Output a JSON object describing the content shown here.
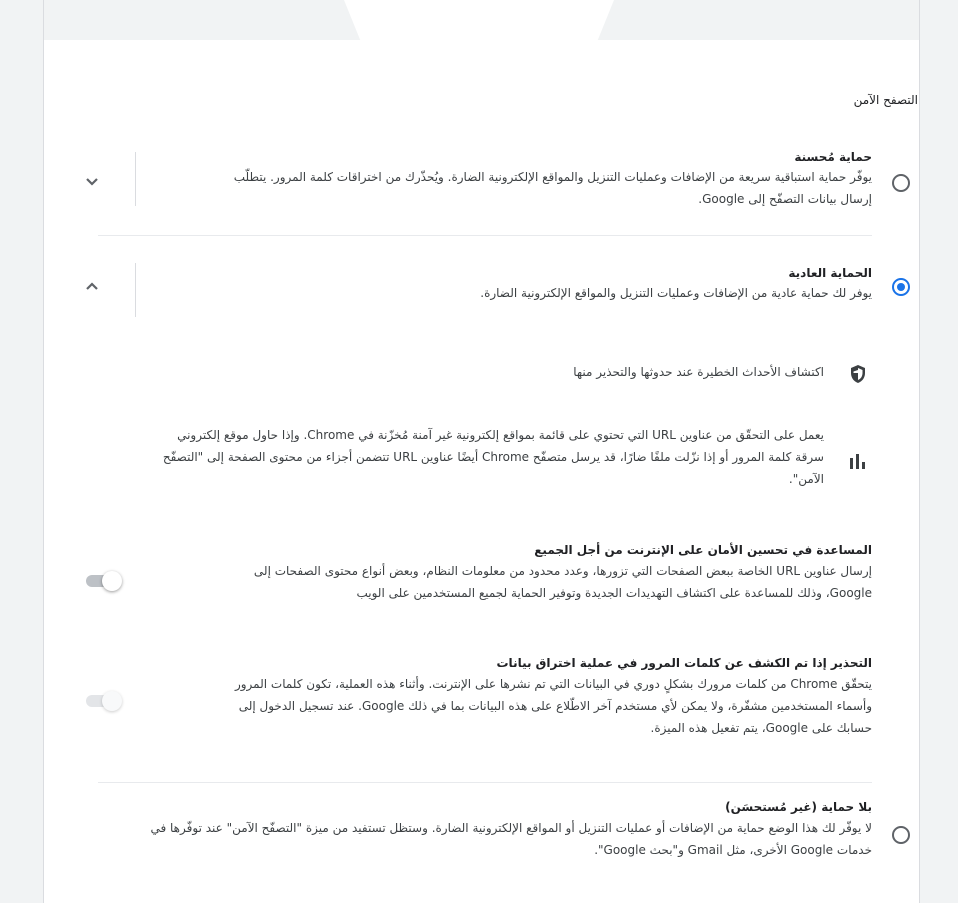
{
  "section_title": "التصفح الآمن",
  "options": {
    "enhanced": {
      "title": "حماية مُحسنة",
      "desc_line1": "يوفّر حماية استباقية سريعة من الإضافات وعمليات التنزيل والمواقع الإلكترونية الضارة. ويُحذّرك من اختراقات كلمة المرور. يتطلّب",
      "desc_line2": "إرسال بيانات التصفّح إلى Google."
    },
    "standard": {
      "title": "الحماية العادية",
      "desc": "يوفر لك حماية عادية من الإضافات وعمليات التنزيل والمواقع الإلكترونية الضارة.",
      "detail1": "اكتشاف الأحداث الخطيرة عند حدوثها والتحذير منها",
      "detail2_line1": "يعمل على التحقّق من عناوين URL التي تحتوي على قائمة بمواقع إلكترونية غير آمنة مُخزّنة في Chrome. وإذا حاول موقع إلكتروني",
      "detail2_line2": "سرقة كلمة المرور أو إذا نزّلت ملفًا ضارًا، قد يرسل متصفّح Chrome أيضًا عناوين URL تتضمن أجزاء من محتوى الصفحة إلى \"التصفّح",
      "detail2_line3": "الآمن\"."
    },
    "none": {
      "title": "بلا حماية (غير مُستحسَن)",
      "desc_line1": "لا يوفّر لك هذا الوضع حماية من الإضافات أو عمليات التنزيل أو المواقع الإلكترونية الضارة. وستظل تستفيد من ميزة \"التصفّح الآمن\" عند توفّرها في",
      "desc_line2": "خدمات Google الأخرى، مثل Gmail و\"بحث Google\"."
    }
  },
  "toggles": {
    "improve": {
      "title": "المساعدة في تحسين الأمان على الإنترنت من أجل الجميع",
      "line1": "إرسال عناوين URL الخاصة ببعض الصفحات التي تزورها، وعدد محدود من معلومات النظام، وبعض أنواع محتوى الصفحات إلى",
      "line2": "Google، وذلك للمساعدة على اكتشاف التهديدات الجديدة وتوفير الحماية لجميع المستخدمين على الويب",
      "state": "off"
    },
    "breach": {
      "title": "التحذير إذا تم الكشف عن كلمات المرور في عملية اختراق بيانات",
      "line1": "يتحقّق Chrome من كلمات مرورك بشكلٍ دوري في البيانات التي تم نشرها على الإنترنت. وأثناء هذه العملية، تكون كلمات المرور",
      "line2": "وأسماء المستخدمين مشفّرة، ولا يمكن لأي مستخدم آخر الاطّلاع على هذه البيانات بما في ذلك Google. عند تسجيل الدخول إلى",
      "line3": "حسابك على Google، يتم تفعيل هذه الميزة.",
      "state": "disabled"
    }
  },
  "icons": {
    "expand": "chevron-down-icon",
    "collapse": "chevron-up-icon",
    "shield": "shield-icon",
    "chart": "bar-chart-icon"
  },
  "colors": {
    "accent": "#1a73e8",
    "text": "#202124",
    "secondary_text": "#3c4043",
    "background": "#f1f3f4"
  }
}
